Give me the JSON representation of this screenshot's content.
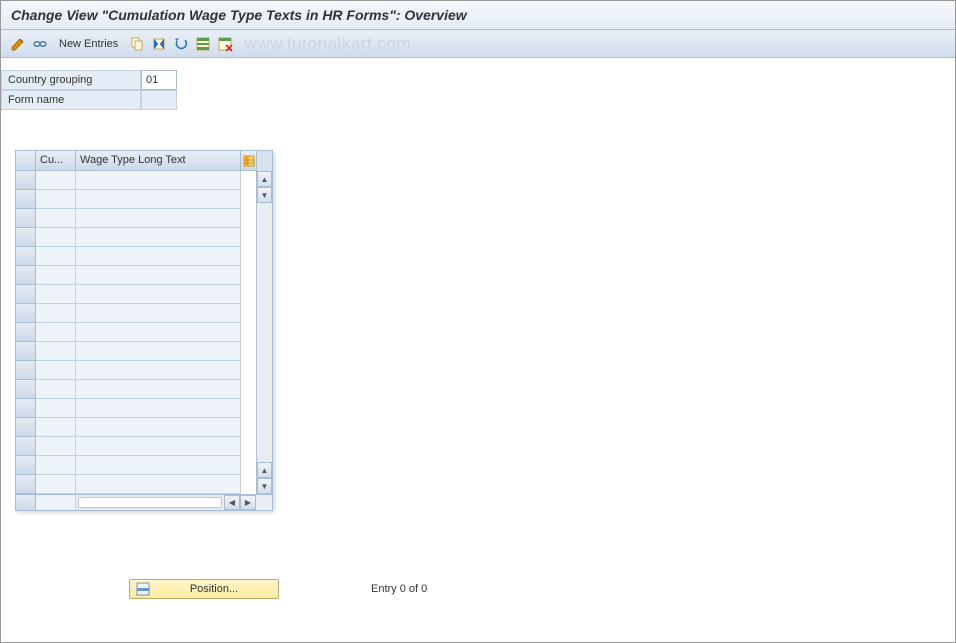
{
  "title": "Change View \"Cumulation Wage Type Texts in HR Forms\": Overview",
  "toolbar": {
    "new_entries_label": "New Entries",
    "watermark": "www.tutorialkart.com"
  },
  "form": {
    "country_grouping_label": "Country grouping",
    "country_grouping_value": "01",
    "form_name_label": "Form name",
    "form_name_value": ""
  },
  "table": {
    "columns": {
      "cu": "Cu...",
      "wage": "Wage Type Long Text"
    },
    "row_count": 17
  },
  "footer": {
    "position_label": "Position...",
    "entry_status": "Entry 0 of 0"
  },
  "icons": {
    "pencil": "pencil-glasses-icon",
    "glasses": "glasses-icon",
    "copy": "copy-icon",
    "save": "save-variant-icon",
    "undo": "undo-icon",
    "select_all": "select-all-icon",
    "deselect": "deselect-icon",
    "table_settings": "table-settings-icon",
    "row_select": "row-select-icon"
  }
}
